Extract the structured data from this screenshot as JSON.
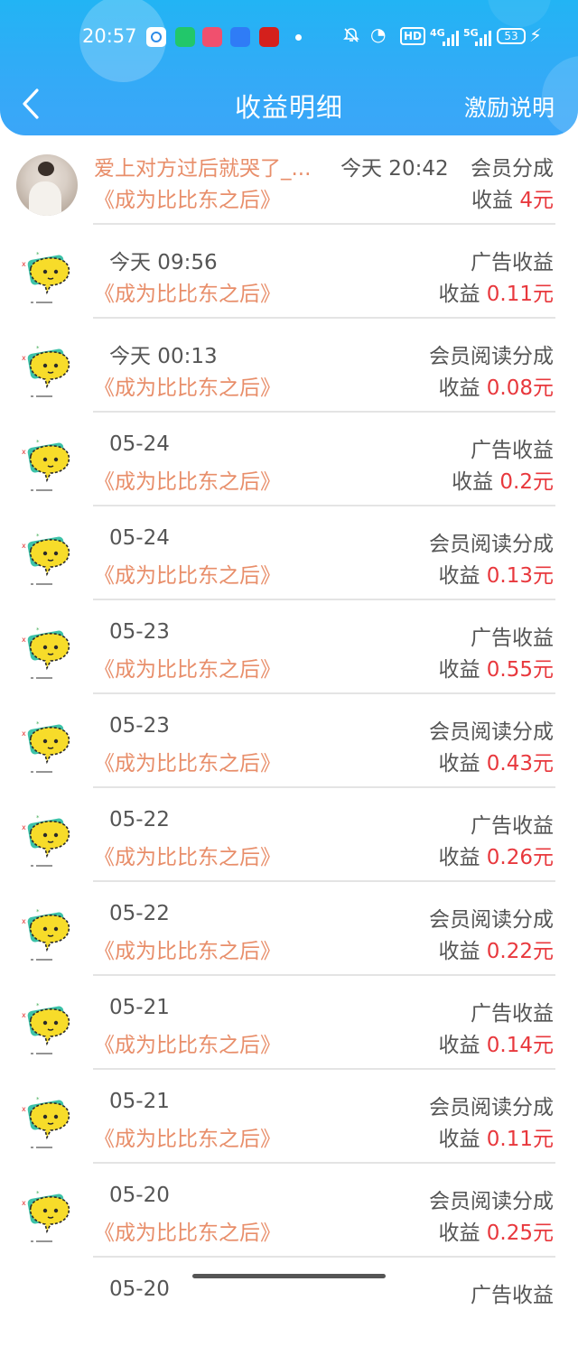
{
  "status_bar": {
    "time": "20:57",
    "hd": "HD",
    "net_a": "4G",
    "net_b": "5G",
    "battery": "53"
  },
  "header": {
    "title": "收益明细",
    "help": "激励说明"
  },
  "first_entry": {
    "user_name": "爱上对方过后就哭了_...",
    "time": "今天 20:42",
    "type": "会员分成",
    "book": "《成为比比东之后》",
    "amount_label": "收益",
    "amount_value": "4元"
  },
  "entries": [
    {
      "time": "今天 09:56",
      "type": "广告收益",
      "book": "《成为比比东之后》",
      "amount_label": "收益",
      "amount_value": "0.11元"
    },
    {
      "time": "今天 00:13",
      "type": "会员阅读分成",
      "book": "《成为比比东之后》",
      "amount_label": "收益",
      "amount_value": "0.08元"
    },
    {
      "time": "05-24",
      "type": "广告收益",
      "book": "《成为比比东之后》",
      "amount_label": "收益",
      "amount_value": "0.2元"
    },
    {
      "time": "05-24",
      "type": "会员阅读分成",
      "book": "《成为比比东之后》",
      "amount_label": "收益",
      "amount_value": "0.13元"
    },
    {
      "time": "05-23",
      "type": "广告收益",
      "book": "《成为比比东之后》",
      "amount_label": "收益",
      "amount_value": "0.55元"
    },
    {
      "time": "05-23",
      "type": "会员阅读分成",
      "book": "《成为比比东之后》",
      "amount_label": "收益",
      "amount_value": "0.43元"
    },
    {
      "time": "05-22",
      "type": "广告收益",
      "book": "《成为比比东之后》",
      "amount_label": "收益",
      "amount_value": "0.26元"
    },
    {
      "time": "05-22",
      "type": "会员阅读分成",
      "book": "《成为比比东之后》",
      "amount_label": "收益",
      "amount_value": "0.22元"
    },
    {
      "time": "05-21",
      "type": "广告收益",
      "book": "《成为比比东之后》",
      "amount_label": "收益",
      "amount_value": "0.14元"
    },
    {
      "time": "05-21",
      "type": "会员阅读分成",
      "book": "《成为比比东之后》",
      "amount_label": "收益",
      "amount_value": "0.11元"
    },
    {
      "time": "05-20",
      "type": "会员阅读分成",
      "book": "《成为比比东之后》",
      "amount_label": "收益",
      "amount_value": "0.25元"
    }
  ],
  "partial_entry": {
    "time": "05-20",
    "type": "广告收益"
  },
  "icons": {
    "back": "back-arrow-icon",
    "avatar_default": "yellow-chat-bubble-icon",
    "avatar_user": "user-photo-avatar"
  },
  "colors": {
    "header": "#22b4f4",
    "book_title": "#e88e6a",
    "amount": "#e8383d",
    "text": "#555555"
  }
}
